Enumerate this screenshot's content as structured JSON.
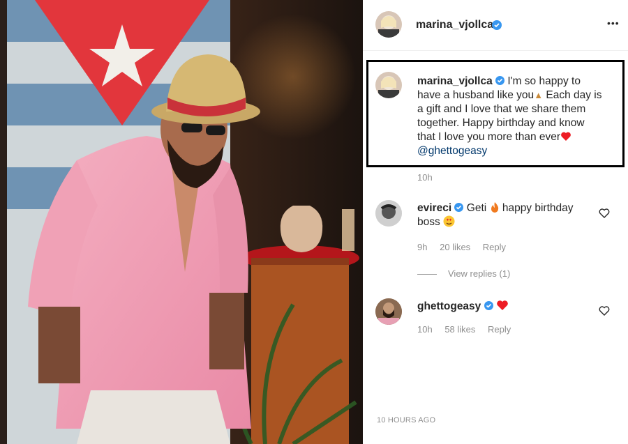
{
  "post": {
    "author": "marina_vjollca",
    "more_label": "•••"
  },
  "caption": {
    "username": "marina_vjollca",
    "lines": [
      "I'm so happy to",
      "have a husband like you",
      "Each day is",
      "a gift and I love that we share them",
      "together. Happy birthday and know",
      "that I love you more than ever"
    ],
    "mention": "@ghettogeasy",
    "time": "10h"
  },
  "comments": [
    {
      "username": "evireci",
      "text_1": "Geti",
      "text_2": "happy birthday",
      "text_3": "boss",
      "time": "9h",
      "likes": "20 likes",
      "reply": "Reply"
    },
    {
      "username": "ghettogeasy",
      "time": "10h",
      "likes": "58 likes",
      "reply": "Reply"
    }
  ],
  "view_replies": "View replies (1)",
  "timestamp": "10 HOURS AGO",
  "colors": {
    "accent": "#3897f0",
    "highlight_border": "#000000",
    "heart_red": "#ed1c24",
    "muted": "#8e8e8e"
  }
}
